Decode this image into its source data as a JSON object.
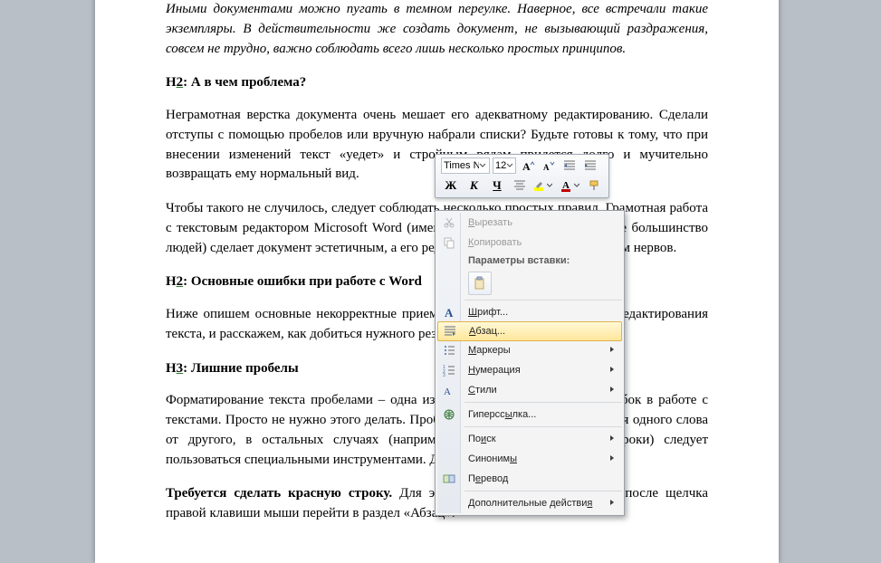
{
  "doc": {
    "intro_italic": "Иными документами можно пугать в темном переулке. Наверное, все встречали такие экземпляры. В действительности же создать документ, не вызывающий раздражения, совсем не трудно, важно соблюдать всего лишь несколько простых принципов.",
    "h1_pre": "Н",
    "h1_num": "2",
    "h1_rest": ": А в чем проблема?",
    "p1": "Неграмотная верстка документа очень мешает его адекватному редактированию. Сделали отступы с помощью пробелов или вручную набрали списки? Будьте готовы к тому, что при внесении изменений текст «уедет» и стройным рядам придется долго и мучительно возвращать ему нормальный вид.",
    "p2": "Чтобы такого не случилось, следует соблюдать несколько простых правил. Грамотная работа с текстовым редактором Microsoft Word (именно им пользуется подавляющее большинство людей) сделает документ эстетичным, а его редактирование не будет стоить вам нервов.",
    "h2_pre": "Н",
    "h2_num": "2",
    "h2_rest": ": Основные ошибки при работе с Word",
    "p3": "Ниже опишем основные некорректные приемы, которые применяются для редактирования текста, и расскажем, как добиться нужного результата легко и быстро.",
    "h3_pre": "Н",
    "h3_num": "3",
    "h3_rest": ": Лишние пробелы",
    "p4": "Форматирование текста пробелами – одна из самых распространенных ошибок в работе с текстами. Просто не нужно этого делать. Пробел создан именно для отделения одного слова от другого, в остальных случаях (например, для создания красной строки) следует пользоваться специальными инструментами. Давайте рассмотрим подробнее.",
    "p5_bold": "Требуется сделать красную строку.",
    "p5_rest": " Для этого нужно выделить текст и после щелчка правой клавиши мыши перейти в раздел «Абзац»."
  },
  "mini": {
    "font": "Times Ne",
    "size": "12",
    "bold": "Ж",
    "italic": "К",
    "underline": "Ч"
  },
  "ctx": {
    "cut": "Вырезать",
    "copy": "Копировать",
    "paste_header": "Параметры вставки:",
    "font": "Шрифт...",
    "paragraph": "Абзац...",
    "bullets": "Маркеры",
    "numbering": "Нумерация",
    "styles": "Стили",
    "hyperlink": "Гиперссылка...",
    "search": "Поиск",
    "synonyms": "Синонимы",
    "translate": "Перевод",
    "extra": "Дополнительные действия"
  }
}
